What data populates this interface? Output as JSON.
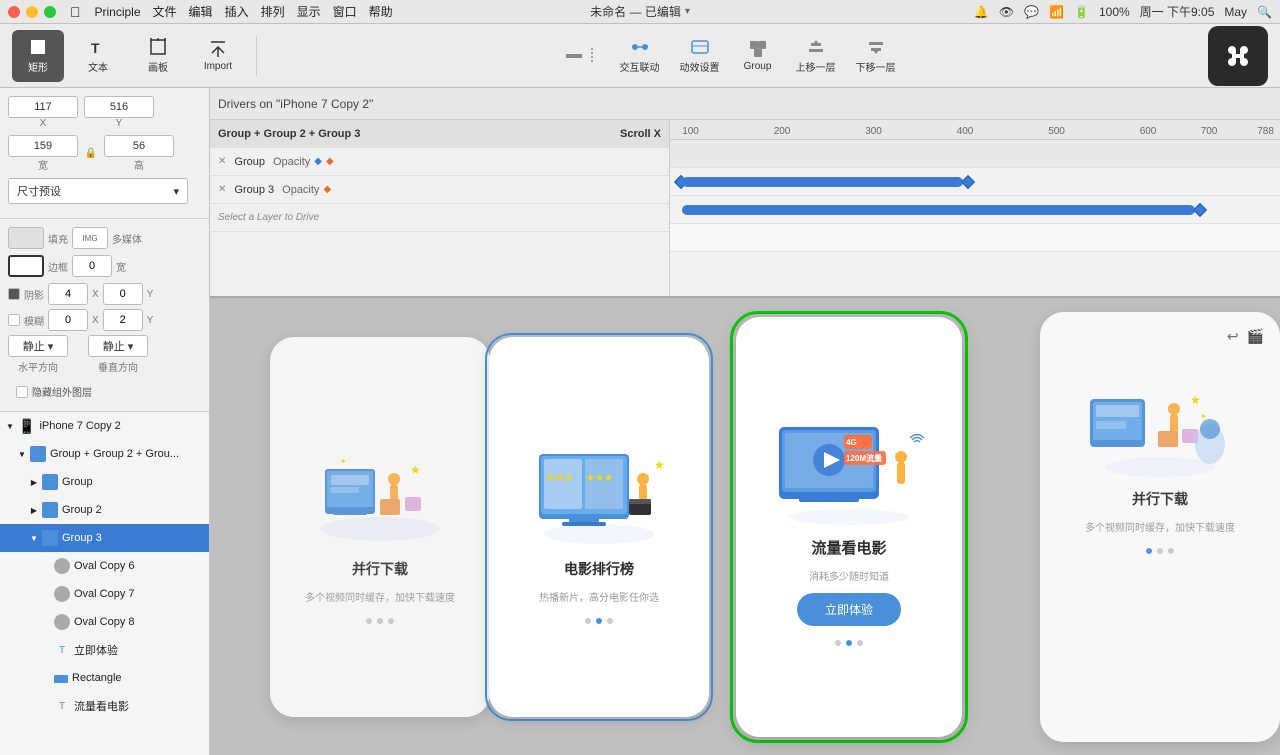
{
  "menubar": {
    "app_icon": "apple-icon",
    "app_name": "Principle",
    "menus": [
      "文件",
      "编辑",
      "插入",
      "排列",
      "显示",
      "窗口",
      "帮助"
    ],
    "title": "未命名 — 已编辑",
    "right_items": [
      "100%",
      "周一 下午9:05",
      "May"
    ]
  },
  "toolbar": {
    "tools": [
      {
        "id": "rect",
        "label": "矩形",
        "icon": "rect-icon"
      },
      {
        "id": "text",
        "label": "文本",
        "icon": "text-icon"
      },
      {
        "id": "artboard",
        "label": "画板",
        "icon": "artboard-icon"
      },
      {
        "id": "import",
        "label": "Import",
        "icon": "import-icon"
      }
    ],
    "center_tools": [
      {
        "id": "interact",
        "label": "交互联动",
        "icon": "interact-icon"
      },
      {
        "id": "animate",
        "label": "动效设置",
        "icon": "animate-icon"
      },
      {
        "id": "group",
        "label": "Group",
        "icon": "group-icon"
      },
      {
        "id": "up",
        "label": "上移一层",
        "icon": "up-layer-icon"
      },
      {
        "id": "down",
        "label": "下移一层",
        "icon": "down-layer-icon"
      }
    ]
  },
  "left_panel": {
    "x_value": "117",
    "y_value": "516",
    "width_value": "159",
    "height_value": "56",
    "x_label": "X",
    "y_label": "Y",
    "width_label": "宽",
    "height_label": "高",
    "preset_label": "尺寸预设",
    "fill_label": "填充",
    "media_label": "多媒体",
    "border_label": "边框",
    "border_width": "0",
    "shadow_label": "阴影",
    "blur_label": "模糊",
    "shadow_x": "4",
    "shadow_y": "0",
    "shadow_x_label": "X",
    "shadow_y_label": "Y",
    "blur_x_val": "0",
    "blur_y_val": "2",
    "horiz_label": "水平方向",
    "vert_label": "垂直方向",
    "hide_groups": "隐藏组外图层",
    "layers": [
      {
        "id": "iphone7copy2",
        "label": "iPhone 7 Copy 2",
        "indent": 0,
        "type": "device",
        "expanded": true
      },
      {
        "id": "group_combined",
        "label": "Group + Group 2 + Grou...",
        "indent": 1,
        "type": "group",
        "expanded": true
      },
      {
        "id": "group",
        "label": "Group",
        "indent": 2,
        "type": "group",
        "expanded": false
      },
      {
        "id": "group2",
        "label": "Group 2",
        "indent": 2,
        "type": "group",
        "expanded": false
      },
      {
        "id": "group3",
        "label": "Group 3",
        "indent": 2,
        "type": "group",
        "expanded": true
      },
      {
        "id": "ovalcopy6",
        "label": "Oval Copy 6",
        "indent": 3,
        "type": "oval"
      },
      {
        "id": "ovalcopy7",
        "label": "Oval Copy 7",
        "indent": 3,
        "type": "oval"
      },
      {
        "id": "ovalcopy8",
        "label": "Oval Copy 8",
        "indent": 3,
        "type": "oval"
      },
      {
        "id": "lijiyanti",
        "label": "立即体验",
        "indent": 3,
        "type": "text"
      },
      {
        "id": "rectangle",
        "label": "Rectangle",
        "indent": 3,
        "type": "rect"
      },
      {
        "id": "liuliangkandianying",
        "label": "流量看电影",
        "indent": 3,
        "type": "text"
      }
    ]
  },
  "timeline": {
    "header_text": "Drivers on \"iPhone 7 Copy 2\"",
    "row1_name": "Group + Group 2 + Group 3",
    "row1_driver": "Scroll X",
    "row2_name": "Group",
    "row2_prop": "Opacity",
    "row3_name": "Group 3",
    "row3_prop": "Opacity",
    "row4_text": "Select a Layer to Drive",
    "ruler_ticks": [
      "100",
      "200",
      "300",
      "400",
      "500",
      "600",
      "700",
      "788"
    ]
  },
  "cards": [
    {
      "id": "card1",
      "title": "并行下载",
      "subtitle": "多个视频同时缓存，加快下载速度",
      "selected": false,
      "dots": [
        false,
        false,
        false
      ]
    },
    {
      "id": "card2",
      "title": "电影排行榜",
      "subtitle": "热播新片，高分电影任你选",
      "selected": false,
      "dots": [
        false,
        true,
        false
      ]
    },
    {
      "id": "card3",
      "title": "流量看电影",
      "subtitle": "消耗多少随时知道",
      "btn_label": "立即体验",
      "selected": true,
      "dots": [
        false,
        true,
        false
      ]
    },
    {
      "id": "card4",
      "title": "并行下载",
      "subtitle": "多个视频同时缓存，加快下载速度",
      "selected": false,
      "dots": [
        false,
        false,
        false
      ]
    }
  ],
  "preview_panel": {
    "undo_icon": "undo-icon",
    "video_icon": "video-icon",
    "title": "并行下载",
    "subtitle": "多个视频同时缓存，加快下载速度",
    "dots": [
      false,
      false,
      false
    ]
  }
}
